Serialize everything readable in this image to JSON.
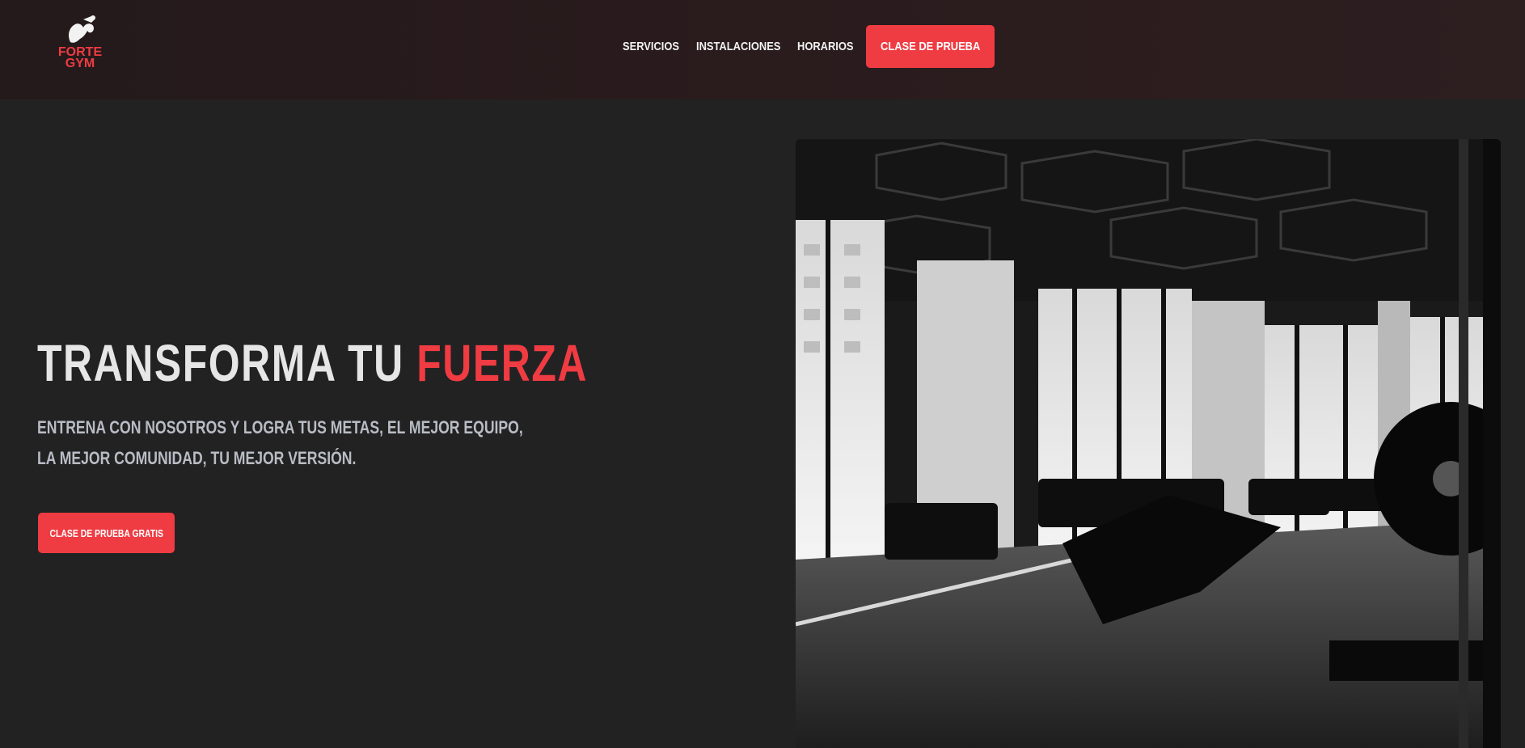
{
  "brand": {
    "line1": "FORTE",
    "line2": "GYM",
    "icon": "flexed-arm-icon",
    "accent_color": "#ef3b42"
  },
  "nav": {
    "links": [
      "SERVICIOS",
      "INSTALACIONES",
      "HORARIOS"
    ],
    "cta_label": "CLASE DE PRUEBA"
  },
  "hero": {
    "title_main": "TRANSFORMA TU ",
    "title_accent": "FUERZA",
    "subtitle": "ENTRENA CON NOSOTROS Y LOGRA TUS METAS, EL MEJOR EQUIPO, LA MEJOR COMUNIDAD, TU MEJOR VERSIÓN.",
    "cta_label": "CLASE DE PRUEBA GRATIS",
    "image_icon": "gym-interior-photo"
  }
}
